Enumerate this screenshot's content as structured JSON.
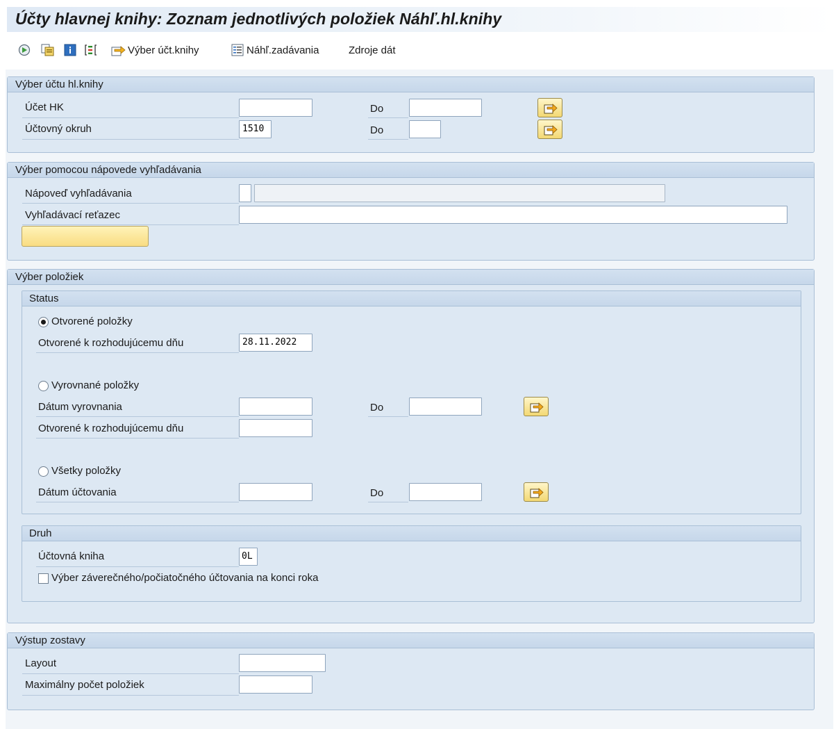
{
  "window": {
    "title": "Účty hlavnej knihy: Zoznam jednotlivých položiek Náhľ.hl.knihy"
  },
  "toolbar": {
    "icons": [
      "execute-icon",
      "copy-variant-icon",
      "info-icon",
      "selection-options-icon"
    ],
    "account_selection_label": "Výber účt.knihy",
    "entry_view_label": "Náhľ.zadávania",
    "data_sources_label": "Zdroje dát"
  },
  "account_selection": {
    "header": "Výber účtu hl.knihy",
    "gl_account_label": "Účet HK",
    "gl_account_from": "",
    "gl_account_to": "",
    "company_code_label": "Účtovný okruh",
    "company_code_from": "1510",
    "company_code_to": "",
    "to_label": "Do"
  },
  "search_help_selection": {
    "header": "Výber pomocou nápovede vyhľadávania",
    "search_help_label": "Nápoveď vyhľadávania",
    "search_help_id": "",
    "search_help_name": "",
    "search_string_label": "Vyhľadávací reťazec",
    "search_string_value": "",
    "button_label": ""
  },
  "item_selection": {
    "header": "Výber položiek",
    "status": {
      "header": "Status",
      "open_items_label": "Otvorené položky",
      "open_items_selected": true,
      "open_at_key_date_label": "Otvorené k rozhodujúcemu dňu",
      "open_at_key_date_value": "28.11.2022",
      "cleared_items_label": "Vyrovnané položky",
      "clearing_date_label": "Dátum vyrovnania",
      "clearing_date_from": "",
      "clearing_date_to": "",
      "cleared_open_at_key_date_label": "Otvorené k rozhodujúcemu dňu",
      "cleared_open_at_key_date_value": "",
      "all_items_label": "Všetky položky",
      "posting_date_label": "Dátum účtovania",
      "posting_date_from": "",
      "posting_date_to": "",
      "to_label": "Do"
    },
    "type": {
      "header": "Druh",
      "ledger_label": "Účtovná kniha",
      "ledger_value": "0L",
      "year_end_closing_label": "Výber záverečného/počiatočného účtovania na konci roka",
      "year_end_closing_checked": false
    }
  },
  "output": {
    "header": "Výstup zostavy",
    "layout_label": "Layout",
    "layout_value": "",
    "max_items_label": "Maximálny počet položiek",
    "max_items_value": ""
  },
  "colors": {
    "group_bg": "#dde8f3",
    "group_border": "#a9bfd6",
    "button_yellow": "#f9dc82"
  }
}
